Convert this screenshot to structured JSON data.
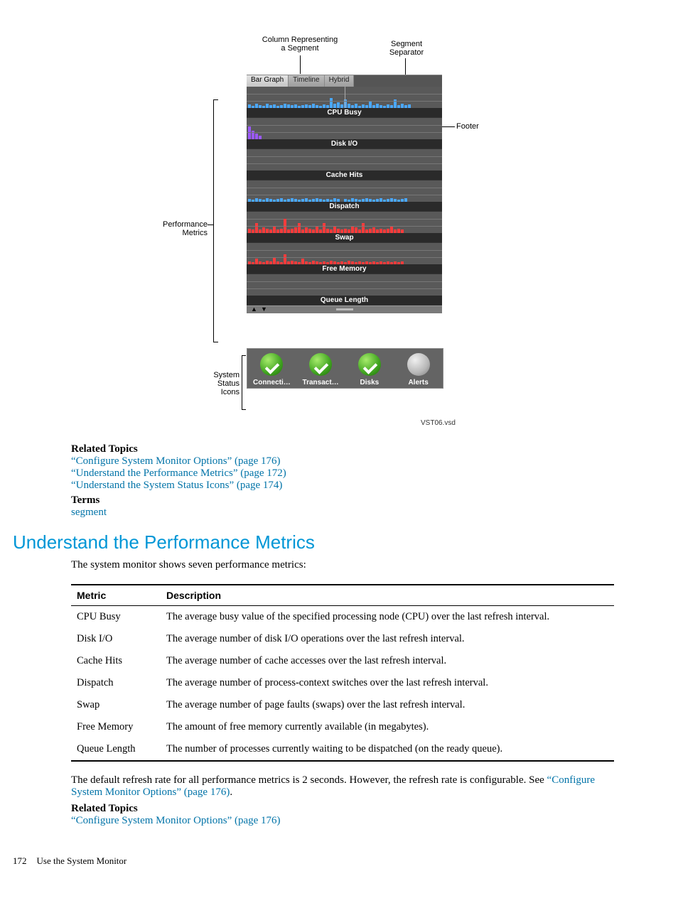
{
  "diagram": {
    "callouts": {
      "column_representing": "Column Representing\na Segment",
      "segment_separator": "Segment\nSeparator",
      "performance_metrics": "Performance\nMetrics",
      "system_status_icons": "System\nStatus\nIcons",
      "footer": "Footer",
      "file_label": "VST06.vsd"
    },
    "tabs": [
      "Bar Graph",
      "Timeline",
      "Hybrid"
    ],
    "metric_rows": [
      "CPU Busy",
      "Disk I/O",
      "Cache Hits",
      "Dispatch",
      "Swap",
      "Free Memory",
      "Queue Length"
    ],
    "status_items": [
      "Connecti…",
      "Transact…",
      "Disks",
      "Alerts"
    ]
  },
  "related1": {
    "heading": "Related Topics",
    "l1a": "“Configure System Monitor Options” (page 176)",
    "l2a": "“Understand the Performance Metrics” (page 172)",
    "l3a": "“Understand the System Status Icons” (page 174)",
    "terms_h": "Terms",
    "t1": "segment"
  },
  "section_heading": "Understand the Performance Metrics",
  "intro": "The system monitor shows seven performance metrics:",
  "table": {
    "h1": "Metric",
    "h2": "Description",
    "rows": [
      {
        "m": "CPU Busy",
        "d": "The average busy value of the specified processing node (CPU) over the last refresh interval."
      },
      {
        "m": "Disk I/O",
        "d": "The average number of disk I/O operations over the last refresh interval."
      },
      {
        "m": "Cache Hits",
        "d": "The average number of cache accesses over the last refresh interval."
      },
      {
        "m": "Dispatch",
        "d": "The average number of process-context switches over the last refresh interval."
      },
      {
        "m": "Swap",
        "d": "The average number of page faults (swaps) over the last refresh interval."
      },
      {
        "m": "Free Memory",
        "d": "The amount of free memory currently available (in megabytes)."
      },
      {
        "m": "Queue Length",
        "d": "The number of processes currently waiting to be dispatched (on the ready queue)."
      }
    ]
  },
  "after1a": "The default refresh rate for all performance metrics is 2 seconds. However, the refresh rate is configurable. See ",
  "after1b": "“Configure System Monitor Options” (page 176)",
  "after1c": ".",
  "related2": {
    "heading": "Related Topics",
    "l1a": "“Configure System Monitor Options” (page 176)"
  },
  "footer": {
    "pnum": "172",
    "ptitle": "Use the System Monitor"
  }
}
